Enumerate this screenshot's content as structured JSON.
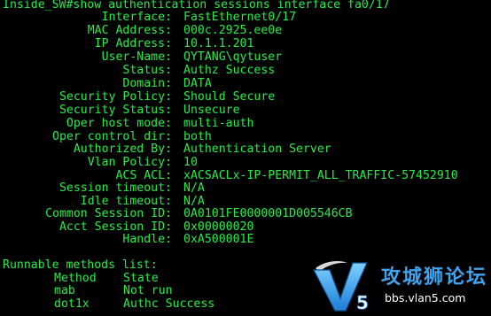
{
  "terminal": {
    "command_line": "Inside_SW#show authentication sessions interface fa0/17",
    "fields": [
      {
        "label": "Interface:",
        "value": "FastEthernet0/17"
      },
      {
        "label": "MAC Address:",
        "value": "000c.2925.ee0e"
      },
      {
        "label": "IP Address:",
        "value": "10.1.1.201"
      },
      {
        "label": "User-Name:",
        "value": "QYTANG\\qytuser"
      },
      {
        "label": "Status:",
        "value": "Authz Success"
      },
      {
        "label": "Domain:",
        "value": "DATA"
      },
      {
        "label": "Security Policy:",
        "value": "Should Secure"
      },
      {
        "label": "Security Status:",
        "value": "Unsecure"
      },
      {
        "label": "Oper host mode:",
        "value": "multi-auth"
      },
      {
        "label": "Oper control dir:",
        "value": "both"
      },
      {
        "label": "Authorized By:",
        "value": "Authentication Server"
      },
      {
        "label": "Vlan Policy:",
        "value": "10"
      },
      {
        "label": "ACS ACL:",
        "value": "xACSACLx-IP-PERMIT_ALL_TRAFFIC-57452910"
      },
      {
        "label": "Session timeout:",
        "value": "N/A"
      },
      {
        "label": "Idle timeout:",
        "value": "N/A"
      },
      {
        "label": "Common Session ID:",
        "value": "0A0101FE0000001D005546CB"
      },
      {
        "label": "Acct Session ID:",
        "value": "0x00000020"
      },
      {
        "label": "Handle:",
        "value": "0xA500001E"
      }
    ],
    "methods": {
      "title": "Runnable methods list:",
      "header_method": "Method",
      "header_state": "State",
      "rows": [
        {
          "method": "mab",
          "state": "Not run"
        },
        {
          "method": "dot1x",
          "state": "Authc Success"
        }
      ]
    },
    "colors": {
      "background": "#000000",
      "text": "#2ee84a"
    }
  },
  "watermark": {
    "logo_icon": "v5-logo-icon",
    "title": "攻城狮论坛",
    "url": "bbs.vlan5.com",
    "title_color": "#3fa3ef"
  }
}
